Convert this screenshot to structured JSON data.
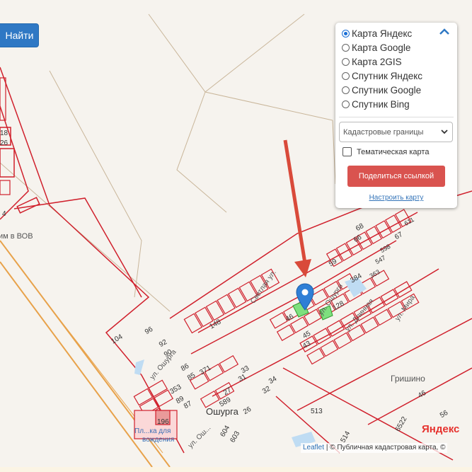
{
  "search": {
    "button_label": "Найти"
  },
  "layers": {
    "base_maps": [
      {
        "label": "Карта Яндекс",
        "selected": true
      },
      {
        "label": "Карта Google",
        "selected": false
      },
      {
        "label": "Карта 2GIS",
        "selected": false
      },
      {
        "label": "Спутник Яндекс",
        "selected": false
      },
      {
        "label": "Спутник Google",
        "selected": false
      },
      {
        "label": "Спутник Bing",
        "selected": false
      }
    ],
    "overlay_select_value": "Кадастровые границы",
    "thematic_label": "Тематическая карта",
    "thematic_checked": false,
    "share_button_label": "Поделиться ссылкой",
    "configure_link": "Настроить карту"
  },
  "map": {
    "labels": {
      "memorial": "им в ВОВ",
      "village_oshurga": "Ошурга",
      "village_south": "Ошурга",
      "settlement_right": "Гришино",
      "poi_bottom_left": "Пл...ка для",
      "poi_bottom_left_2": "вождения",
      "street_svetlaya": "Светлая ул.",
      "street_osurga": "ул. Ошурга",
      "street_osurgi2": "ул. Ошурги",
      "street_dlinnaya": "ул. Длинная",
      "street_mira": "ул. Мира",
      "street_south": "ул. Ош..."
    },
    "parcel_numbers": [
      "68",
      "66",
      "67",
      "611",
      "598",
      "547",
      "59",
      "384",
      "128",
      "148",
      "104",
      "96",
      "92",
      "90",
      "86",
      "85",
      "371",
      "46",
      "45",
      "43",
      "33",
      "31",
      "34",
      "32",
      "27",
      "589",
      "26",
      "353",
      "89",
      "87",
      "196",
      "513",
      "604",
      "603",
      "514",
      "46",
      "56",
      "6522",
      "18",
      "26",
      "4",
      "363"
    ],
    "marker_icon": "map-pin-icon",
    "arrow_color": "#d94a3a",
    "parcel_color": "#d0202c",
    "highlight_color": "#7ee07e"
  },
  "attribution": {
    "leaflet": "Leaflet",
    "source": "| © Публичная кадастровая карта, ©"
  },
  "logo": {
    "text": "Яндекс"
  }
}
